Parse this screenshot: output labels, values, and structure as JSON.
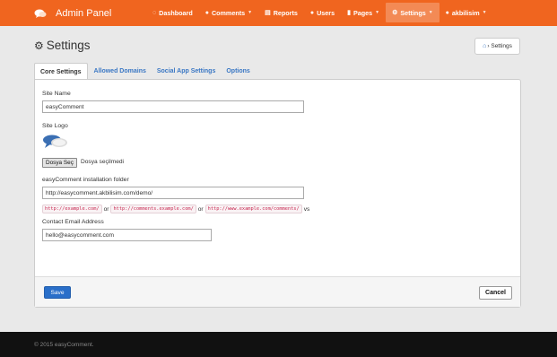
{
  "brand": {
    "title": "Admin Panel",
    "logo_icon": "chat-bubbles-icon"
  },
  "colors": {
    "navbar": "#f0651f",
    "navbar_active": "#f38a55",
    "link": "#3a77c4",
    "primary_button": "#2a6fc9",
    "footer": "#111111"
  },
  "nav": {
    "items": [
      {
        "label": "Dashboard",
        "icon": "dashboard-icon",
        "dropdown": false
      },
      {
        "label": "Comments",
        "icon": "comment-icon",
        "dropdown": true
      },
      {
        "label": "Reports",
        "icon": "list-icon",
        "dropdown": false
      },
      {
        "label": "Users",
        "icon": "users-icon",
        "dropdown": false
      },
      {
        "label": "Pages",
        "icon": "file-icon",
        "dropdown": true
      },
      {
        "label": "Settings",
        "icon": "gear-icon",
        "dropdown": true,
        "active": true
      },
      {
        "label": "akbilisim",
        "icon": "user-icon",
        "dropdown": true
      }
    ]
  },
  "page": {
    "title": "Settings",
    "breadcrumb": "Settings"
  },
  "tabs": [
    {
      "label": "Core Settings",
      "active": true
    },
    {
      "label": "Allowed Domains"
    },
    {
      "label": "Social App Settings"
    },
    {
      "label": "Options"
    }
  ],
  "form": {
    "site_name": {
      "label": "Site Name",
      "value": "easyComment"
    },
    "site_logo": {
      "label": "Site Logo",
      "button": "Dosya Seç",
      "status": "Dosya seçilmedi"
    },
    "install_folder": {
      "label": "easyComment installation folder",
      "value": "http://easycomment.akbilisim.com/demo/",
      "examples": [
        "http://example.com/",
        "http://comments.example.com/",
        "http://www.example.com/comments/"
      ],
      "separators": [
        "or",
        "or",
        "vs"
      ]
    },
    "contact_email": {
      "label": "Contact Email Address",
      "value": "hello@easycomment.com"
    }
  },
  "buttons": {
    "save": "Save",
    "cancel": "Cancel"
  },
  "footer": {
    "copyright": "© 2015 easyComment."
  }
}
